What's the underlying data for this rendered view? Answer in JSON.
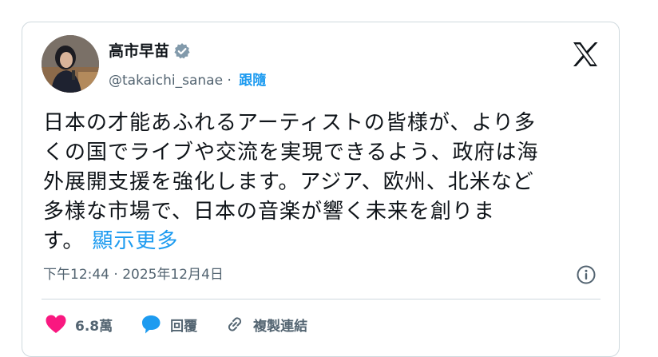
{
  "author": {
    "name": "高市早苗",
    "handle": "@takaichi_sanae",
    "separator": " · ",
    "follow_label": "跟隨"
  },
  "tweet": {
    "text": "日本の才能あふれるアーティストの皆様が、より多\nくの国でライブや交流を実現できるよう、政府は海\n外展開支援を強化します。アジア、欧州、北米など\n多様な市場で、日本の音楽が響く未来を創りま\nす。",
    "show_more": "顯示更多",
    "timestamp": "下午12:44 · 2025年12月4日"
  },
  "actions": {
    "likes": "6.8萬",
    "reply": "回覆",
    "copy_link": "複製連結"
  },
  "colors": {
    "accent": "#1d9bf0",
    "like": "#f91880",
    "secondary_text": "#536471",
    "border": "#cfd9de"
  },
  "icons": [
    "verified-badge-icon",
    "x-logo-icon",
    "info-icon",
    "heart-icon",
    "reply-bubble-icon",
    "link-icon"
  ]
}
